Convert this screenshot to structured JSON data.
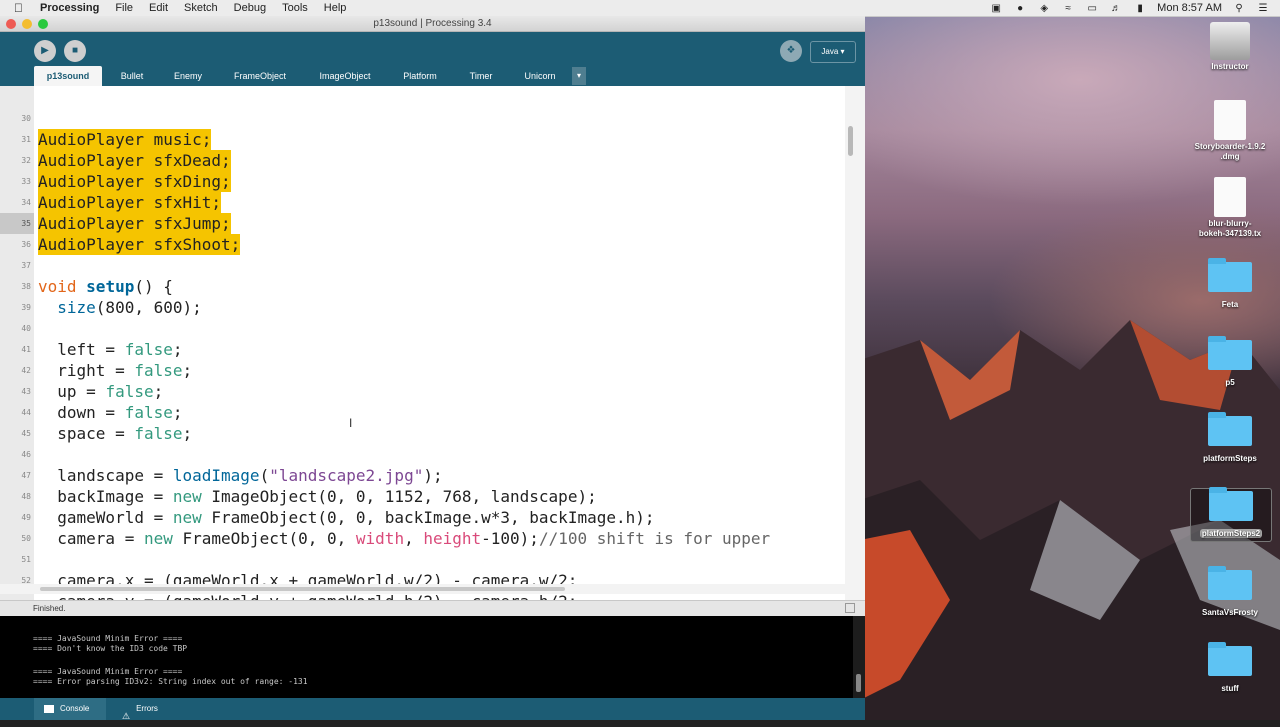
{
  "menubar": {
    "app_name": "Processing",
    "items": [
      "File",
      "Edit",
      "Sketch",
      "Debug",
      "Tools",
      "Help"
    ],
    "clock": "Mon 8:57 AM"
  },
  "window": {
    "title": "p13sound | Processing 3.4",
    "mode": "Java ▾",
    "tabs": [
      "p13sound",
      "Bullet",
      "Enemy",
      "FrameObject",
      "ImageObject",
      "Platform",
      "Timer",
      "Unicorn"
    ],
    "tab_menu": "▾"
  },
  "editor": {
    "lines": [
      {
        "n": "30",
        "t": "AudioPlayer music;"
      },
      {
        "n": "31",
        "t": "AudioPlayer sfxDead;"
      },
      {
        "n": "32",
        "t": "AudioPlayer sfxDing;"
      },
      {
        "n": "33",
        "t": "AudioPlayer sfxHit;"
      },
      {
        "n": "34",
        "t": "AudioPlayer sfxJump;"
      },
      {
        "n": "35",
        "t": "AudioPlayer sfxShoot;"
      },
      {
        "n": "36",
        "t": ""
      },
      {
        "n": "37",
        "t": "void setup() {"
      },
      {
        "n": "38",
        "t": "  size(800, 600);"
      },
      {
        "n": "39",
        "t": ""
      },
      {
        "n": "40",
        "t": "  left = false;"
      },
      {
        "n": "41",
        "t": "  right = false;"
      },
      {
        "n": "42",
        "t": "  up = false;"
      },
      {
        "n": "43",
        "t": "  down = false;"
      },
      {
        "n": "44",
        "t": "  space = false;"
      },
      {
        "n": "45",
        "t": ""
      },
      {
        "n": "46",
        "t": "  landscape = loadImage(\"landscape2.jpg\");"
      },
      {
        "n": "47",
        "t": "  backImage = new ImageObject(0, 0, 1152, 768, landscape);"
      },
      {
        "n": "48",
        "t": "  gameWorld = new FrameObject(0, 0, backImage.w*3, backImage.h);"
      },
      {
        "n": "49",
        "t": "  camera = new FrameObject(0, 0, width, height-100);//100 shift is for upper"
      },
      {
        "n": "50",
        "t": ""
      },
      {
        "n": "51",
        "t": "  camera.x = (gameWorld.x + gameWorld.w/2) - camera.w/2;"
      },
      {
        "n": "52",
        "t": "  camera.y = (gameWorld.y + gameWorld.h/2) - camera.h/2;"
      }
    ]
  },
  "status": {
    "text": "Finished."
  },
  "console": {
    "lines": [
      "==== JavaSound Minim Error ====",
      "==== Don't know the ID3 code TBP",
      "",
      "==== JavaSound Minim Error ====",
      "==== Error parsing ID3v2: String index out of range: -131"
    ],
    "tabs": [
      "Console",
      "Errors"
    ]
  },
  "desktop": {
    "icons": [
      "Instructor",
      "Storyboarder-1.9.2\n.dmg",
      "blur-blurry-\nbokeh-347139.tx",
      "Feta",
      "p5",
      "platformSteps",
      "platformSteps2",
      "SantaVsFrosty",
      "stuff"
    ]
  },
  "colors": {
    "toolbar": "#1c5c74",
    "highlight": "#f5c400",
    "keyword_type": "#e2661a",
    "constant": "#33997e"
  }
}
